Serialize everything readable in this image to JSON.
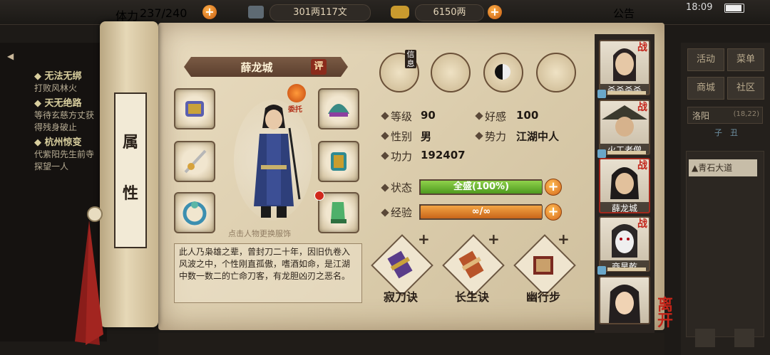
{
  "topbar": {
    "stamina_label": "体力",
    "stamina": "237/240",
    "silver": "301两117文",
    "gold": "6150两",
    "notice": "公告",
    "time": "18:09"
  },
  "quests": [
    {
      "title": "无法无绑",
      "desc": "打败风林火"
    },
    {
      "title": "天无绝路",
      "desc": "等待玄慈方丈获得残身破止"
    },
    {
      "title": "杭州惊变",
      "desc": "代紫阳先生前寺探望一人"
    }
  ],
  "right_menu": {
    "buttons": [
      "活动",
      "菜单",
      "商城",
      "社区"
    ],
    "location": "洛阳",
    "coords": "(18,22)",
    "tabs": [
      "子",
      "丑"
    ],
    "road": "青石大道"
  },
  "scroll": {
    "tab_chars": [
      "属",
      "性"
    ]
  },
  "character": {
    "name": "薛龙城",
    "review_badge": "评",
    "delegate": "委托",
    "change_hint": "点击人物更换服饰",
    "bio": "此人乃枭雄之辈，曾封刀二十年，因旧仇卷入风波之中，个性刚直孤傲，嗜酒如命，是江湖中数一数二的亡命刀客，有龙胆凶刃之恶名。"
  },
  "info_icons": [
    {
      "label": "信息",
      "icon": "hat-icon"
    },
    {
      "label": "",
      "icon": "box-icon"
    },
    {
      "label": "",
      "icon": "bagua-icon"
    },
    {
      "label": "",
      "icon": "meridian-icon"
    }
  ],
  "stats": {
    "level_label": "等级",
    "level": "90",
    "favor_label": "好感",
    "favor": "100",
    "gender_label": "性别",
    "gender": "男",
    "faction_label": "势力",
    "faction": "江湖中人",
    "power_label": "功力",
    "power": "192407",
    "status_label": "状态",
    "status": "全盛(100%)",
    "status_fill": 1.0,
    "exp_label": "经验",
    "exp": "∞/∞",
    "exp_fill": 1.0
  },
  "skills": [
    {
      "name": "寂刀诀",
      "plus": "+"
    },
    {
      "name": "长生诀",
      "plus": "+"
    },
    {
      "name": "幽行步",
      "plus": "+"
    }
  ],
  "party": [
    {
      "name": "杀杀杀杀",
      "tag": "战"
    },
    {
      "name": "火工老僧",
      "tag": "战"
    },
    {
      "name": "薛龙城",
      "tag": "战"
    },
    {
      "name": "商昊乾",
      "tag": "战"
    },
    {
      "name": "",
      "tag": ""
    }
  ],
  "exit_label": "离开",
  "colors": {
    "accent": "#d4661a",
    "status_green": "#6cb834",
    "tag_red": "#c3261c"
  }
}
